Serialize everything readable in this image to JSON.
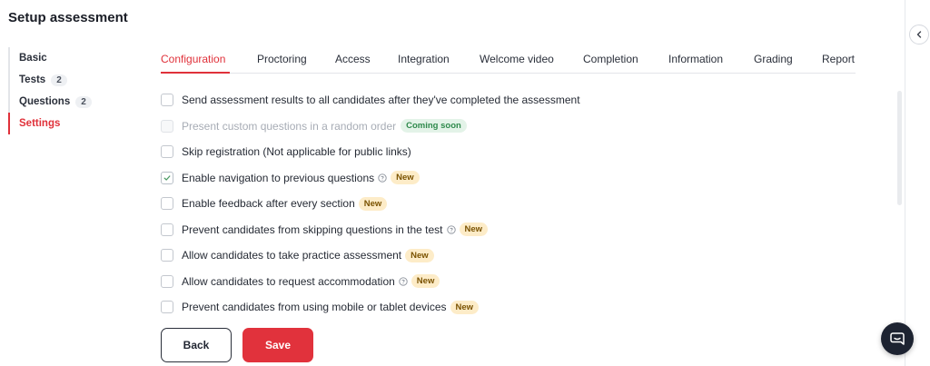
{
  "page": {
    "title": "Setup assessment"
  },
  "sidebar": {
    "items": [
      {
        "label": "Basic",
        "count": ""
      },
      {
        "label": "Tests",
        "count": "2"
      },
      {
        "label": "Questions",
        "count": "2"
      },
      {
        "label": "Settings",
        "count": "",
        "active": true
      }
    ]
  },
  "tabs": [
    {
      "label": "Configuration",
      "active": true
    },
    {
      "label": "Proctoring"
    },
    {
      "label": "Access"
    },
    {
      "label": "Integration"
    },
    {
      "label": "Welcome video"
    },
    {
      "label": "Completion"
    },
    {
      "label": "Information"
    },
    {
      "label": "Grading"
    },
    {
      "label": "Report"
    }
  ],
  "options": [
    {
      "label": "Send assessment results to all candidates after they've completed the assessment",
      "checked": false
    },
    {
      "label": "Present custom questions in a random order",
      "checked": false,
      "disabled": true,
      "badge": "Coming soon"
    },
    {
      "label": "Skip registration (Not applicable for public links)",
      "checked": false
    },
    {
      "label": "Enable navigation to previous questions",
      "checked": true,
      "help": true,
      "badge": "New"
    },
    {
      "label": "Enable feedback after every section",
      "checked": false,
      "badge": "New"
    },
    {
      "label": "Prevent candidates from skipping questions in the test",
      "checked": false,
      "help": true,
      "badge": "New"
    },
    {
      "label": "Allow candidates to take practice assessment",
      "checked": false,
      "badge": "New"
    },
    {
      "label": "Allow candidates to request accommodation",
      "checked": false,
      "help": true,
      "badge": "New"
    },
    {
      "label": "Prevent candidates from using mobile or tablet devices",
      "checked": false,
      "badge": "New"
    }
  ],
  "actions": {
    "back_label": "Back",
    "save_label": "Save"
  },
  "colors": {
    "accent": "#e0313a",
    "new_badge_bg": "#fdecc8",
    "soon_badge_bg": "#e3f3e8",
    "chat_bg": "#1d2331"
  },
  "icons": {
    "collapse": "chevron-left-icon",
    "help": "question-circle-icon",
    "chat": "chat-bubble-icon",
    "check": "check-icon"
  }
}
